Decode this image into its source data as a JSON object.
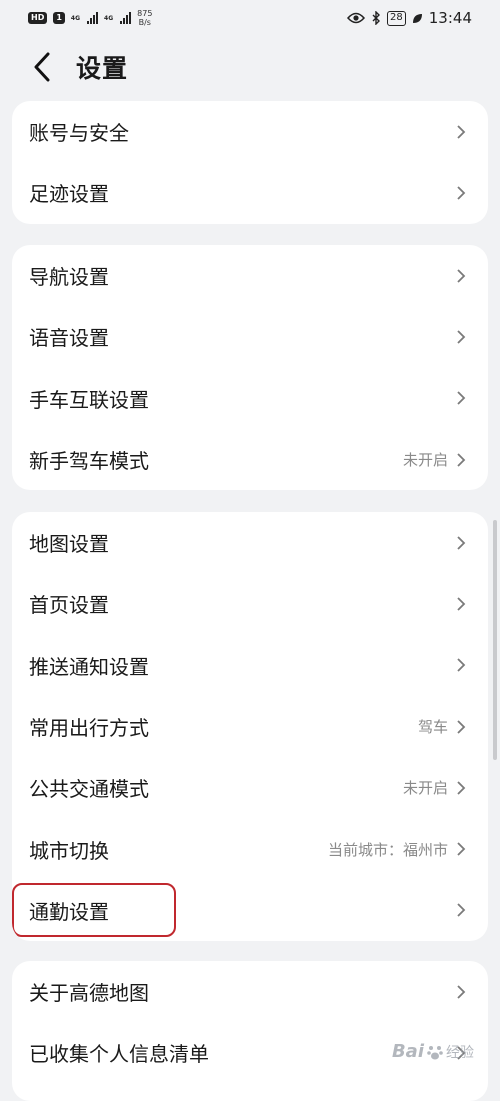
{
  "status_bar": {
    "hd_badge": "HD",
    "sim1_tag": "1",
    "net1": "4G",
    "net2": "4G",
    "speed_value": "875",
    "speed_unit": "B/s",
    "battery": "28",
    "time": "13:44"
  },
  "header": {
    "title": "设置"
  },
  "groups": [
    {
      "items": [
        {
          "label": "账号与安全",
          "value": ""
        },
        {
          "label": "足迹设置",
          "value": ""
        }
      ]
    },
    {
      "items": [
        {
          "label": "导航设置",
          "value": ""
        },
        {
          "label": "语音设置",
          "value": ""
        },
        {
          "label": "手车互联设置",
          "value": ""
        },
        {
          "label": "新手驾车模式",
          "value": "未开启"
        }
      ]
    },
    {
      "items": [
        {
          "label": "地图设置",
          "value": ""
        },
        {
          "label": "首页设置",
          "value": ""
        },
        {
          "label": "推送通知设置",
          "value": ""
        },
        {
          "label": "常用出行方式",
          "value": "驾车"
        },
        {
          "label": "公共交通模式",
          "value": "未开启"
        },
        {
          "label": "城市切换",
          "value": "当前城市：福州市"
        },
        {
          "label": "通勤设置",
          "value": ""
        }
      ]
    },
    {
      "items": [
        {
          "label": "关于高德地图",
          "value": ""
        },
        {
          "label": "已收集个人信息清单",
          "value": ""
        }
      ]
    }
  ],
  "highlight_color": "#c0282e",
  "watermark": {
    "text": "Bai",
    "suffix": "经验"
  }
}
